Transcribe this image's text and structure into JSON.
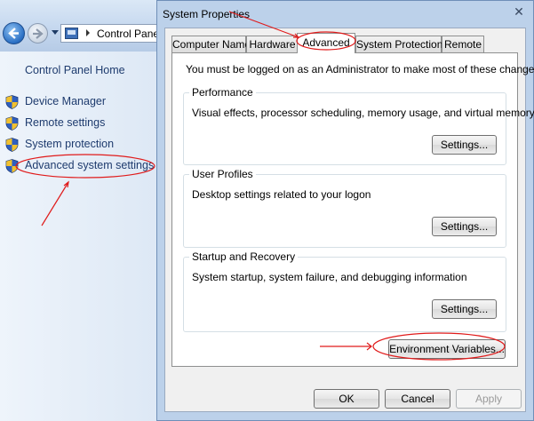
{
  "explorer": {
    "address_text": "Control Panel",
    "sidebar": {
      "home_label": "Control Panel Home",
      "tasks": [
        {
          "label": "Device Manager",
          "icon": "uac-shield-icon"
        },
        {
          "label": "Remote settings",
          "icon": "uac-shield-icon"
        },
        {
          "label": "System protection",
          "icon": "uac-shield-icon"
        },
        {
          "label": "Advanced system settings",
          "icon": "uac-shield-icon"
        }
      ]
    }
  },
  "dialog": {
    "title": "System Properties",
    "close_glyph": "✕",
    "tabs": [
      {
        "label": "Computer Name",
        "active": false
      },
      {
        "label": "Hardware",
        "active": false
      },
      {
        "label": "Advanced",
        "active": true
      },
      {
        "label": "System Protection",
        "active": false
      },
      {
        "label": "Remote",
        "active": false
      }
    ],
    "admin_note": "You must be logged on as an Administrator to make most of these changes.",
    "groups": [
      {
        "title": "Performance",
        "description": "Visual effects, processor scheduling, memory usage, and virtual memory",
        "button": "Settings..."
      },
      {
        "title": "User Profiles",
        "description": "Desktop settings related to your logon",
        "button": "Settings..."
      },
      {
        "title": "Startup and Recovery",
        "description": "System startup, system failure, and debugging information",
        "button": "Settings..."
      }
    ],
    "env_button": "Environment Variables...",
    "footer": {
      "ok": "OK",
      "cancel": "Cancel",
      "apply": "Apply"
    }
  },
  "colors": {
    "annotation": "#e01b1b",
    "link": "#1e3b6e",
    "dialog_frame": "#bcd1ea"
  }
}
